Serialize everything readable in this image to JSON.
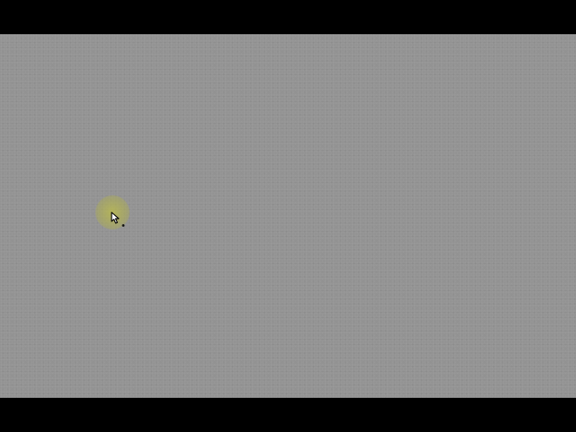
{
  "screen": {
    "letterbox_color": "#000000",
    "desktop_color": "#939393"
  },
  "cursor": {
    "icon": "arrow-pointer-icon",
    "highlight": "click-highlight",
    "highlight_color": "#bebe46"
  }
}
